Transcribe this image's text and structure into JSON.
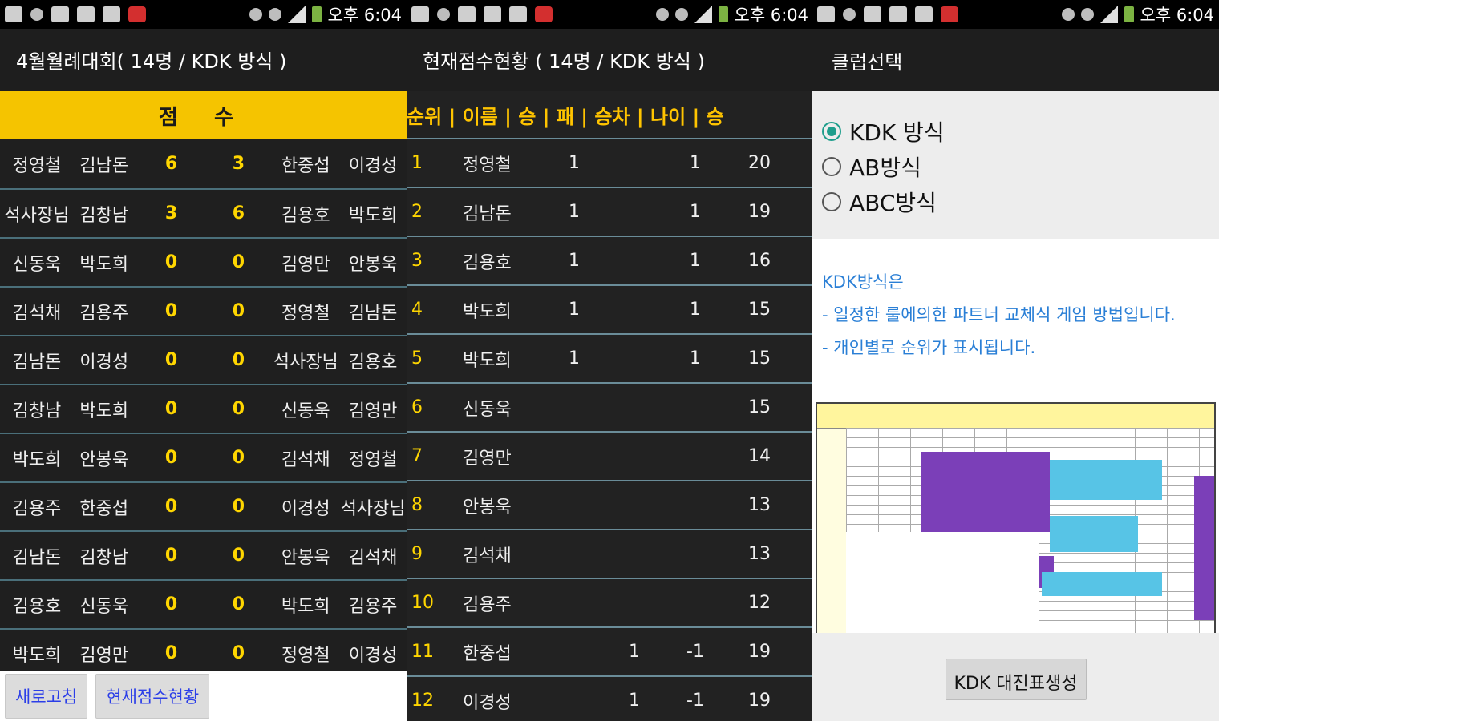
{
  "status": {
    "time": "오후 6:04"
  },
  "screen1": {
    "title": "4월월례대회( 14명 / KDK 방식 )",
    "score_header": "점 수",
    "matches": [
      {
        "p1": "정영철",
        "p2": "김남돈",
        "s1": "6",
        "s2": "3",
        "p3": "한중섭",
        "p4": "이경성"
      },
      {
        "p1": "석사장님",
        "p2": "김창남",
        "s1": "3",
        "s2": "6",
        "p3": "김용호",
        "p4": "박도희"
      },
      {
        "p1": "신동욱",
        "p2": "박도희",
        "s1": "0",
        "s2": "0",
        "p3": "김영만",
        "p4": "안봉욱"
      },
      {
        "p1": "김석채",
        "p2": "김용주",
        "s1": "0",
        "s2": "0",
        "p3": "정영철",
        "p4": "김남돈"
      },
      {
        "p1": "김남돈",
        "p2": "이경성",
        "s1": "0",
        "s2": "0",
        "p3": "석사장님",
        "p4": "김용호"
      },
      {
        "p1": "김창남",
        "p2": "박도희",
        "s1": "0",
        "s2": "0",
        "p3": "신동욱",
        "p4": "김영만"
      },
      {
        "p1": "박도희",
        "p2": "안봉욱",
        "s1": "0",
        "s2": "0",
        "p3": "김석채",
        "p4": "정영철"
      },
      {
        "p1": "김용주",
        "p2": "한중섭",
        "s1": "0",
        "s2": "0",
        "p3": "이경성",
        "p4": "석사장님"
      },
      {
        "p1": "김남돈",
        "p2": "김창남",
        "s1": "0",
        "s2": "0",
        "p3": "안봉욱",
        "p4": "김석채"
      },
      {
        "p1": "김용호",
        "p2": "신동욱",
        "s1": "0",
        "s2": "0",
        "p3": "박도희",
        "p4": "김용주"
      },
      {
        "p1": "박도희",
        "p2": "김영만",
        "s1": "0",
        "s2": "0",
        "p3": "정영철",
        "p4": "이경성"
      }
    ],
    "refresh_button": "새로고침",
    "status_button": "현재점수현황"
  },
  "screen2": {
    "title": "현재점수현황 ( 14명 / KDK 방식 )",
    "header": "순위 | 이름 | 승 | 패 | 승차 | 나이 | 승",
    "rows": [
      {
        "rank": "1",
        "name": "정영철",
        "win": "1",
        "loss": "",
        "diff": "1",
        "age": "20"
      },
      {
        "rank": "2",
        "name": "김남돈",
        "win": "1",
        "loss": "",
        "diff": "1",
        "age": "19"
      },
      {
        "rank": "3",
        "name": "김용호",
        "win": "1",
        "loss": "",
        "diff": "1",
        "age": "16"
      },
      {
        "rank": "4",
        "name": "박도희",
        "win": "1",
        "loss": "",
        "diff": "1",
        "age": "15"
      },
      {
        "rank": "5",
        "name": "박도희",
        "win": "1",
        "loss": "",
        "diff": "1",
        "age": "15"
      },
      {
        "rank": "6",
        "name": "신동욱",
        "win": "",
        "loss": "",
        "diff": "",
        "age": "15"
      },
      {
        "rank": "7",
        "name": "김영만",
        "win": "",
        "loss": "",
        "diff": "",
        "age": "14"
      },
      {
        "rank": "8",
        "name": "안봉욱",
        "win": "",
        "loss": "",
        "diff": "",
        "age": "13"
      },
      {
        "rank": "9",
        "name": "김석채",
        "win": "",
        "loss": "",
        "diff": "",
        "age": "13"
      },
      {
        "rank": "10",
        "name": "김용주",
        "win": "",
        "loss": "",
        "diff": "",
        "age": "12"
      },
      {
        "rank": "11",
        "name": "한중섭",
        "win": "",
        "loss": "1",
        "diff": "-1",
        "age": "19"
      },
      {
        "rank": "12",
        "name": "이경성",
        "win": "",
        "loss": "1",
        "diff": "-1",
        "age": "19"
      }
    ]
  },
  "screen3": {
    "title": "클럽선택",
    "options": [
      "KDK 방식",
      "AB방식",
      "ABC방식"
    ],
    "selected_index": 0,
    "desc_title": "KDK방식은",
    "desc_line1": "- 일정한 룰에의한 파트너 교체식 게임 방법입니다.",
    "desc_line2": "- 개인별로 순위가 표시됩니다.",
    "generate_button": "KDK 대진표생성"
  }
}
